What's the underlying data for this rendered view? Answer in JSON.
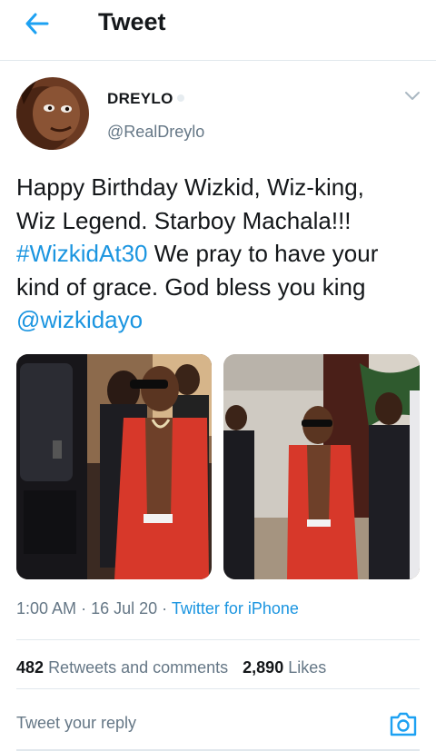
{
  "header": {
    "title": "Tweet",
    "back_icon": "arrow-left-icon",
    "accent": "#1da1f2"
  },
  "tweet": {
    "author": {
      "display_name": "DREYLO",
      "handle": "@RealDreylo"
    },
    "text": {
      "line1": "Happy Birthday Wizkid, Wiz-king,",
      "line2": "Wiz Legend. Starboy Machala!!!",
      "hashtag": "#WizkidAt30",
      "line3_rest": " We pray to have your",
      "line4": "kind of grace. God bless you king",
      "mention": "@wizkidayo"
    },
    "time": "1:00 AM",
    "separator": "·",
    "date": "16 Jul 20",
    "source": "Twitter for iPhone",
    "stats": {
      "retweets_count": "482",
      "retweets_label": "Retweets and comments",
      "likes_count": "2,890",
      "likes_label": "Likes"
    }
  },
  "reply": {
    "placeholder": "Tweet your reply",
    "camera_icon": "camera-icon"
  },
  "colors": {
    "link": "#1b95e0",
    "secondary_text": "#657786",
    "primary_text": "#14171a",
    "divider": "#e1e8ed"
  }
}
